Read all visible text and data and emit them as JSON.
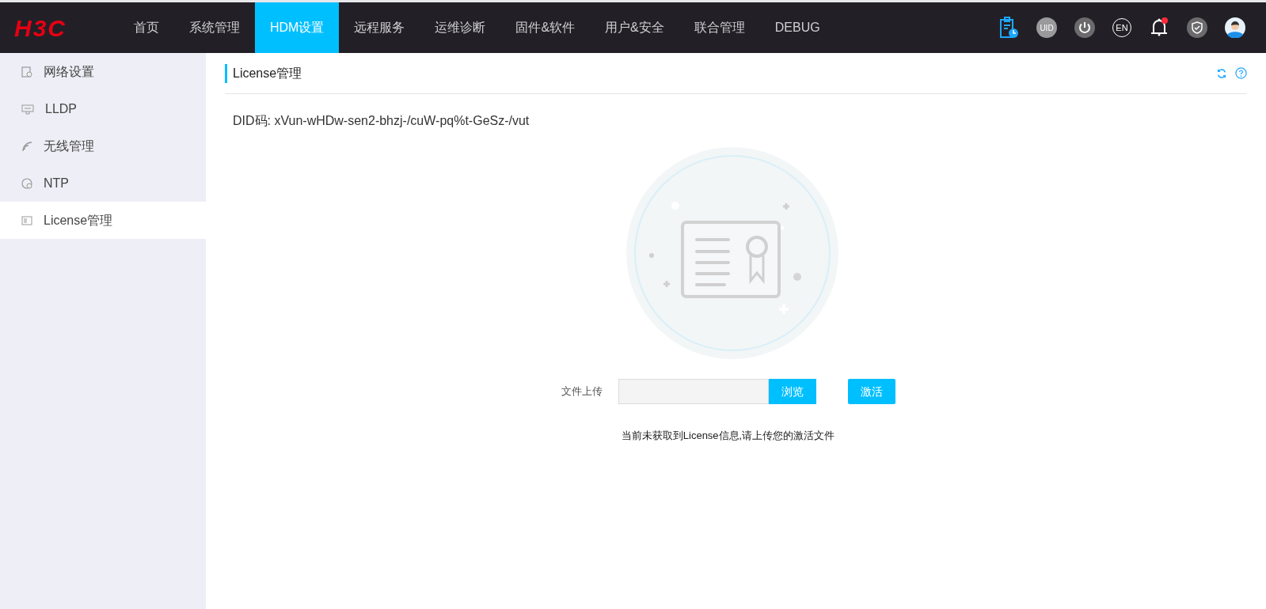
{
  "logo": "H3C",
  "nav": [
    {
      "label": "首页",
      "selected": false
    },
    {
      "label": "系统管理",
      "selected": false
    },
    {
      "label": "HDM设置",
      "selected": true
    },
    {
      "label": "远程服务",
      "selected": false
    },
    {
      "label": "运维诊断",
      "selected": false
    },
    {
      "label": "固件&软件",
      "selected": false
    },
    {
      "label": "用户&安全",
      "selected": false
    },
    {
      "label": "联合管理",
      "selected": false
    },
    {
      "label": "DEBUG",
      "selected": false
    }
  ],
  "toolbar": {
    "uid_label": "UID",
    "language": "EN",
    "has_notification": true
  },
  "sidebar": {
    "items": [
      {
        "label": "网络设置",
        "kind": "network",
        "selected": false
      },
      {
        "label": "LLDP",
        "kind": "lldp",
        "selected": false
      },
      {
        "label": "无线管理",
        "kind": "wireless",
        "selected": false
      },
      {
        "label": "NTP",
        "kind": "ntp",
        "selected": false
      },
      {
        "label": "License管理",
        "kind": "license",
        "selected": true
      }
    ]
  },
  "page": {
    "title": "License管理",
    "did_label": "DID码:",
    "did_value": "xVun-wHDw-sen2-bhzj-/cuW-pq%t-GeSz-/vut",
    "upload_label": "文件上传",
    "browse_button": "浏览",
    "activate_button": "激活",
    "message": "当前未获取到License信息,请上传您的激活文件"
  }
}
